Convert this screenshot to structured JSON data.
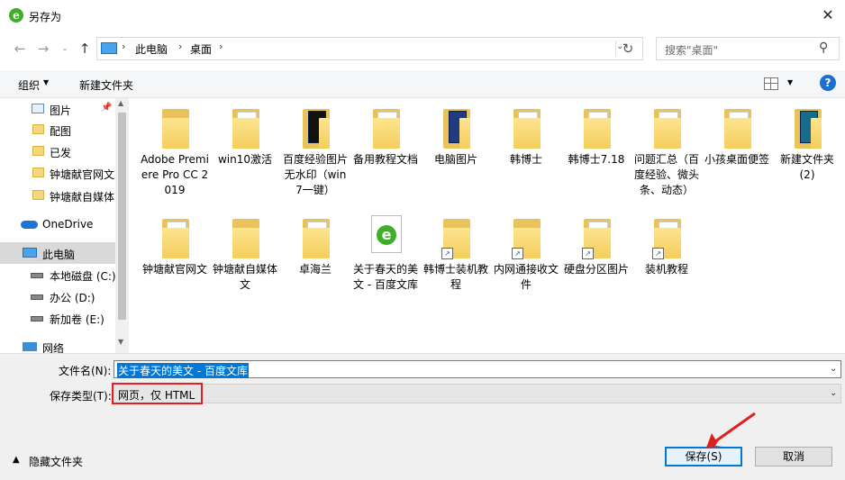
{
  "window": {
    "title": "另存为"
  },
  "nav": {
    "breadcrumb": [
      "此电脑",
      "桌面"
    ],
    "search_placeholder": "搜索\"桌面\""
  },
  "toolbar": {
    "organize": "组织",
    "new_folder": "新建文件夹"
  },
  "sidebar": {
    "items": [
      {
        "label": "图片",
        "icon": "pictures-folder-icon",
        "pinned": true
      },
      {
        "label": "配图",
        "icon": "folder-icon"
      },
      {
        "label": "已发",
        "icon": "folder-icon"
      },
      {
        "label": "钟塘献官网文",
        "icon": "folder-icon"
      },
      {
        "label": "钟塘献自媒体",
        "icon": "folder-icon"
      },
      {
        "label": "OneDrive",
        "icon": "onedrive-icon"
      },
      {
        "label": "此电脑",
        "icon": "computer-icon",
        "selected": true
      },
      {
        "label": "本地磁盘 (C:)",
        "icon": "drive-icon"
      },
      {
        "label": "办公 (D:)",
        "icon": "drive-icon"
      },
      {
        "label": "新加卷 (E:)",
        "icon": "drive-icon"
      },
      {
        "label": "网络",
        "icon": "network-icon"
      }
    ]
  },
  "files": [
    {
      "name": "Adobe Premiere Pro CC 2019",
      "icon": "folder-icon"
    },
    {
      "name": "win10激活",
      "icon": "folder-icon"
    },
    {
      "name": "百度经验图片无水印（win7一键）",
      "icon": "folder-dark-icon"
    },
    {
      "name": "备用教程文档",
      "icon": "folder-icon"
    },
    {
      "name": "电脑图片",
      "icon": "folder-dark-icon"
    },
    {
      "name": "韩博士",
      "icon": "folder-icon"
    },
    {
      "name": "韩博士7.18",
      "icon": "folder-icon"
    },
    {
      "name": "问题汇总（百度经验、微头条、动态）",
      "icon": "folder-icon"
    },
    {
      "name": "小孩桌面便签",
      "icon": "folder-icon"
    },
    {
      "name": "新建文件夹 (2)",
      "icon": "folder-dark-icon"
    },
    {
      "name": "钟塘献官网文",
      "icon": "folder-icon"
    },
    {
      "name": "钟塘献自媒体文",
      "icon": "folder-icon"
    },
    {
      "name": "卓海兰",
      "icon": "folder-icon"
    },
    {
      "name": "关于春天的美文 - 百度文库",
      "icon": "ie-html-file-icon"
    },
    {
      "name": "韩博士装机教程",
      "icon": "folder-shortcut-icon"
    },
    {
      "name": "内网通接收文件",
      "icon": "folder-shortcut-icon"
    },
    {
      "name": "硬盘分区图片",
      "icon": "folder-shortcut-icon"
    },
    {
      "name": "装机教程",
      "icon": "folder-shortcut-icon"
    }
  ],
  "form": {
    "filename_label": "文件名(N):",
    "filename_value": "关于春天的美文 - 百度文库",
    "filetype_label": "保存类型(T):",
    "filetype_value": "网页，仅 HTML",
    "hide_folders": "隐藏文件夹",
    "save": "保存(S)",
    "cancel": "取消"
  },
  "colors": {
    "accent": "#0078d7",
    "highlight": "#e02020",
    "folder": "#f4ce5c"
  }
}
